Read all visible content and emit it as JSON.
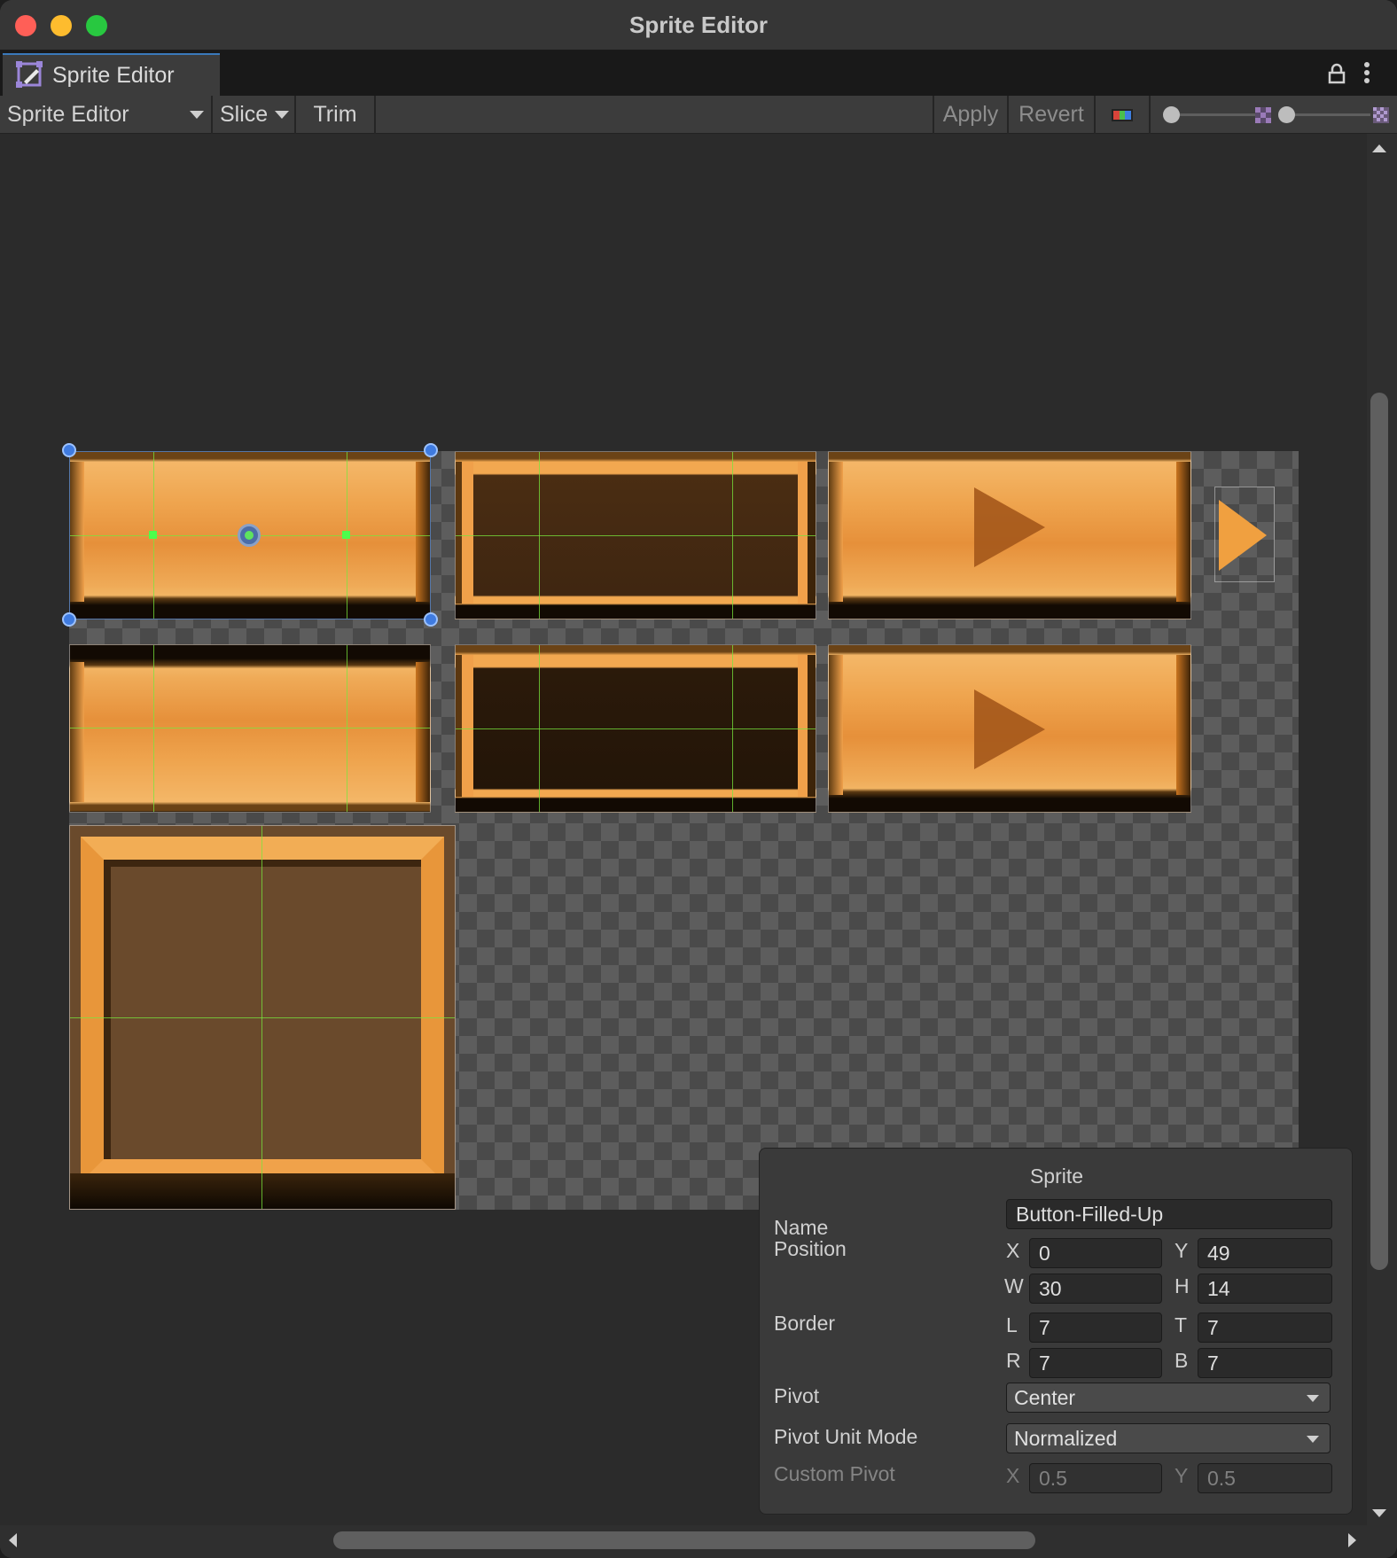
{
  "window": {
    "title": "Sprite Editor"
  },
  "tab": {
    "label": "Sprite Editor",
    "icon": "sprite-editor-icon"
  },
  "toolbar": {
    "mode": "Sprite Editor",
    "slice": "Slice",
    "trim": "Trim",
    "apply": "Apply",
    "revert": "Revert"
  },
  "inspector": {
    "title": "Sprite",
    "name_label": "Name",
    "name_value": "Button-Filled-Up",
    "position_label": "Position",
    "x_axis": "X",
    "x_value": "0",
    "y_axis": "Y",
    "y_value": "49",
    "w_axis": "W",
    "w_value": "30",
    "h_axis": "H",
    "h_value": "14",
    "border_label": "Border",
    "l_axis": "L",
    "l_value": "7",
    "t_axis": "T",
    "t_value": "7",
    "r_axis": "R",
    "r_value": "7",
    "b_axis": "B",
    "b_value": "7",
    "pivot_label": "Pivot",
    "pivot_value": "Center",
    "pivot_unit_label": "Pivot Unit Mode",
    "pivot_unit_value": "Normalized",
    "custom_pivot_label": "Custom Pivot",
    "cp_x_axis": "X",
    "cp_x_value": "0.5",
    "cp_y_axis": "Y",
    "cp_y_value": "0.5"
  },
  "colors": {
    "accent": "#3a79bb",
    "guide": "#78e63c",
    "handle": "#3f7be0",
    "sprite_orange": "#efa54f"
  }
}
